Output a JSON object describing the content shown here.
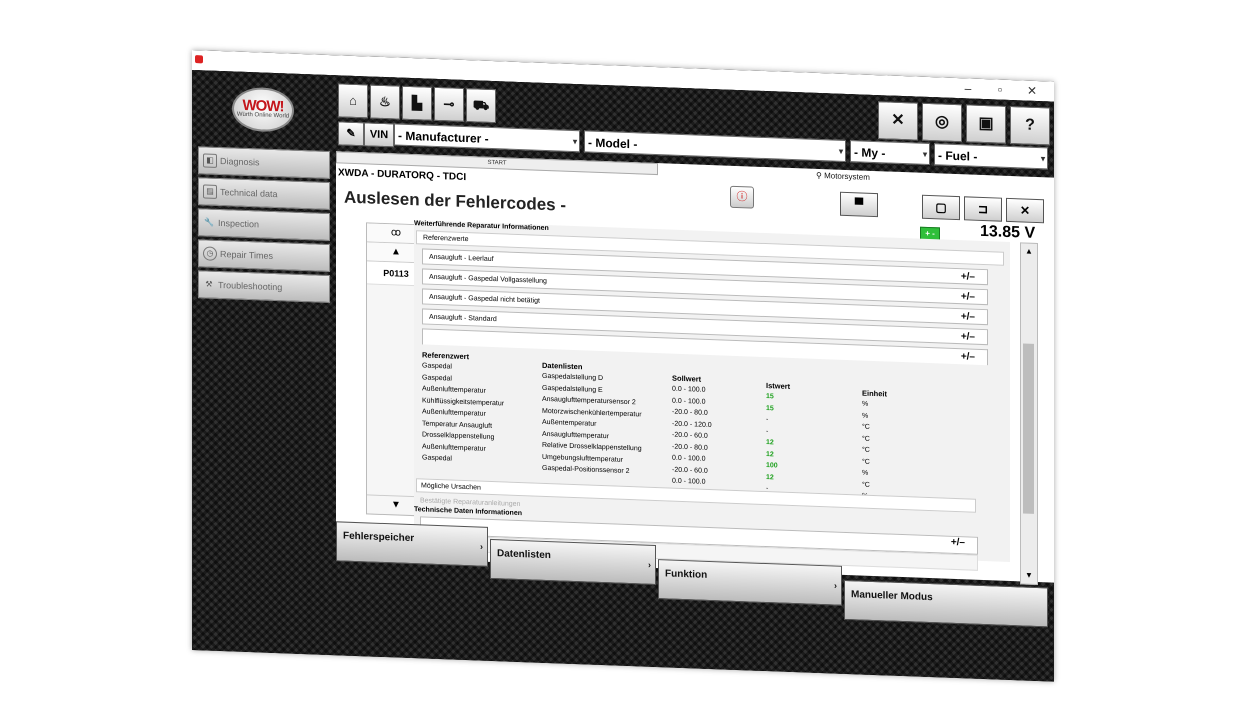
{
  "window": {
    "controls": {
      "minimize": "–",
      "maximize": "▫",
      "close": "✕"
    }
  },
  "logo": {
    "text": "WOW!",
    "subtitle": "Würth Online World"
  },
  "nav": {
    "items": [
      {
        "label": "Diagnosis",
        "icon": "diagnosis-icon"
      },
      {
        "label": "Technical data",
        "icon": "document-icon"
      },
      {
        "label": "Inspection",
        "icon": "wrench-icon"
      },
      {
        "label": "Repair Times",
        "icon": "clock-icon"
      },
      {
        "label": "Troubleshooting",
        "icon": "tools-icon"
      }
    ]
  },
  "toolbar": {
    "left_icons": [
      "home-icon",
      "oil-icon",
      "factory-icon",
      "key-icon",
      "car-icon"
    ],
    "right_buttons": [
      {
        "name": "close-tool",
        "glyph": "✕"
      },
      {
        "name": "sensor",
        "glyph": "◎"
      },
      {
        "name": "battery-test",
        "glyph": "▣"
      },
      {
        "name": "help",
        "glyph": "?"
      }
    ],
    "vin_label": "VIN",
    "manufacturer": "- Manufacturer -",
    "model": "- Model -",
    "my": "- My -",
    "fuel": "- Fuel -"
  },
  "content": {
    "start_label": "START",
    "motorsystem": "Motorsystem",
    "vehicle": "XWDA - DURATORQ - TDCI",
    "heading": "Auslesen der Fehlercodes -",
    "voltage": "13.85 V",
    "battery_label": "+ -",
    "codes": [
      "P0113"
    ],
    "panel_title": "Weiterführende Reparatur Informationen",
    "referenzwerte": "Referenzwerte",
    "accordion": [
      {
        "label": "Ansaugluft - Leerlauf",
        "toggle": "+/–"
      },
      {
        "label": "Ansaugluft - Gaspedal Vollgasstellung",
        "toggle": "+/–"
      },
      {
        "label": "Ansaugluft - Gaspedal nicht betätigt",
        "toggle": "+/–"
      },
      {
        "label": "Ansaugluft - Standard",
        "toggle": "+/–"
      },
      {
        "label": "",
        "toggle": "+/–"
      }
    ],
    "table": {
      "headers": {
        "ref": "Referenzwert",
        "data": "Datenlisten",
        "soll": "Sollwert",
        "ist": "Istwert",
        "einheit": "Einheit"
      },
      "rows": [
        {
          "ref": "Gaspedal",
          "data": "Gaspedalstellung D",
          "soll": "0.0 - 100.0",
          "ist": "15",
          "einheit": "%"
        },
        {
          "ref": "Gaspedal",
          "data": "Gaspedalstellung E",
          "soll": "0.0 - 100.0",
          "ist": "15",
          "einheit": "%"
        },
        {
          "ref": "Außenlufttemperatur",
          "data": "Ansauglufttemperatursensor 2",
          "soll": "-20.0 - 80.0",
          "ist": "-",
          "einheit": "°C"
        },
        {
          "ref": "Kühlflüssigkeitstemperatur",
          "data": "Motorzwischenkühlertemperatur",
          "soll": "-20.0 - 120.0",
          "ist": "-",
          "einheit": "°C"
        },
        {
          "ref": "Außenlufttemperatur",
          "data": "Außentemperatur",
          "soll": "-20.0 - 60.0",
          "ist": "12",
          "einheit": "°C"
        },
        {
          "ref": "Temperatur Ansaugluft",
          "data": "Ansauglufttemperatur",
          "soll": "-20.0 - 80.0",
          "ist": "12",
          "einheit": "°C"
        },
        {
          "ref": "Drosselklappenstellung",
          "data": "Relative Drosselklappenstellung",
          "soll": "0.0 - 100.0",
          "ist": "100",
          "einheit": "%"
        },
        {
          "ref": "Außenlufttemperatur",
          "data": "Umgebungslufttemperatur",
          "soll": "-20.0 - 60.0",
          "ist": "12",
          "einheit": "°C"
        },
        {
          "ref": "Gaspedal",
          "data": "Gaspedal-Positionssensor 2",
          "soll": "0.0 - 100.0",
          "ist": "-",
          "einheit": "%"
        }
      ]
    },
    "moegliche_ursachen": "Mögliche Ursachen",
    "bestaetigte": "Bestätigte Reparaturanleitungen",
    "tech_title": "Technische Daten Informationen",
    "tech_toggle": "+/–"
  },
  "bottom_tabs": [
    {
      "label": "Fehlerspeicher"
    },
    {
      "label": "Datenlisten"
    },
    {
      "label": "Funktion"
    },
    {
      "label": "Manueller Modus"
    }
  ]
}
